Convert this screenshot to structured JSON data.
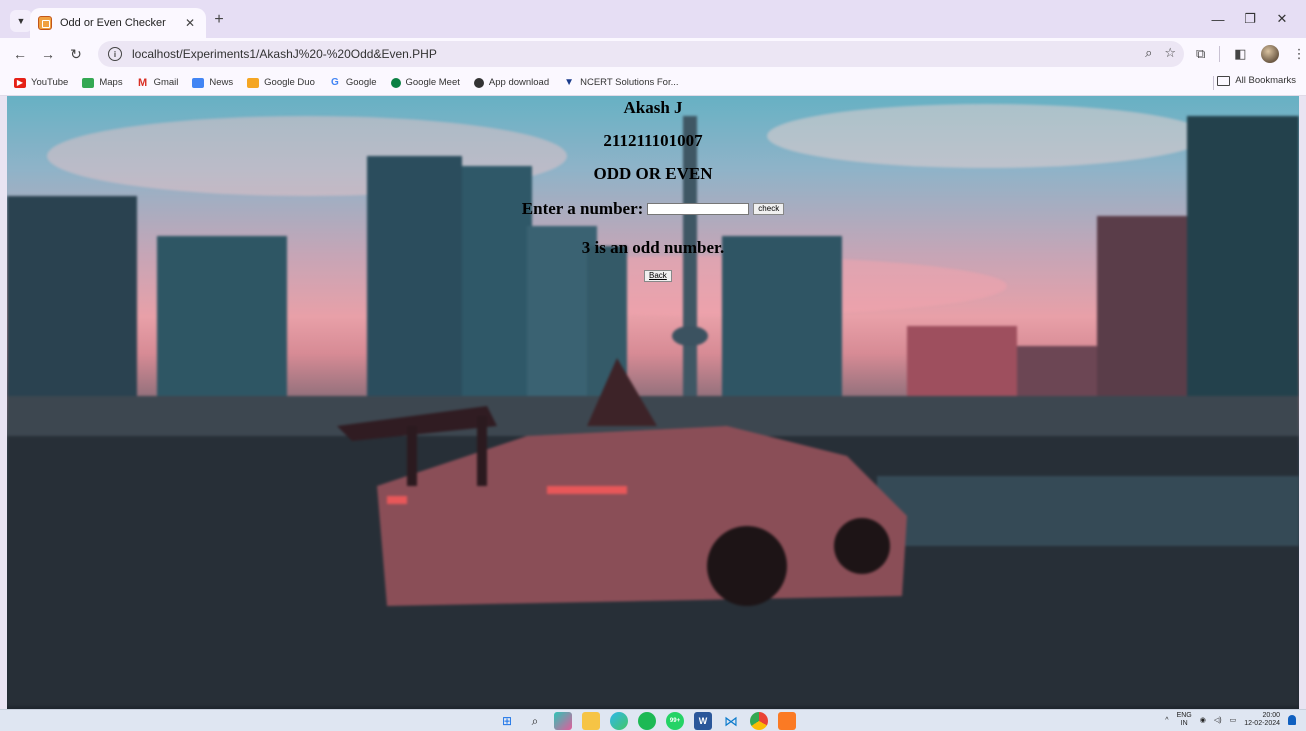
{
  "browser": {
    "tab_title": "Odd or Even Checker",
    "url": "localhost/Experiments1/AkashJ%20-%20Odd&Even.PHP",
    "bookmarks": [
      {
        "label": "YouTube",
        "icon": "youtube-icon",
        "color": "#e62117"
      },
      {
        "label": "Maps",
        "icon": "maps-icon",
        "color": "#34a853"
      },
      {
        "label": "Gmail",
        "icon": "gmail-icon",
        "color": "#d93025"
      },
      {
        "label": "News",
        "icon": "news-icon",
        "color": "#4285f4"
      },
      {
        "label": "Google Duo",
        "icon": "duo-icon",
        "color": "#f5a623"
      },
      {
        "label": "Google",
        "icon": "google-icon",
        "color": "#4285f4"
      },
      {
        "label": "Google Meet",
        "icon": "meet-icon",
        "color": "#0b8043"
      },
      {
        "label": "App download",
        "icon": "globe-icon",
        "color": "#333333"
      },
      {
        "label": "NCERT Solutions For...",
        "icon": "ncert-icon",
        "color": "#1a3c8c"
      }
    ],
    "all_bookmarks_label": "All Bookmarks"
  },
  "page": {
    "name": "Akash J",
    "register_no": "211211101007",
    "heading": "ODD OR EVEN",
    "input_label": "Enter a number:",
    "input_value": "",
    "check_label": "check",
    "result": "3 is an odd number.",
    "back_label": "Back"
  },
  "taskbar": {
    "apps": [
      "windows-start-icon",
      "search-icon",
      "copilot-icon",
      "file-explorer-icon",
      "edge-icon",
      "spotify-icon",
      "whatsapp-icon",
      "word-icon",
      "vscode-icon",
      "chrome-icon",
      "xampp-icon"
    ],
    "whatsapp_badge": "99+",
    "lang_top": "ENG",
    "lang_bottom": "IN",
    "time": "20:00",
    "date": "12-02-2024"
  }
}
